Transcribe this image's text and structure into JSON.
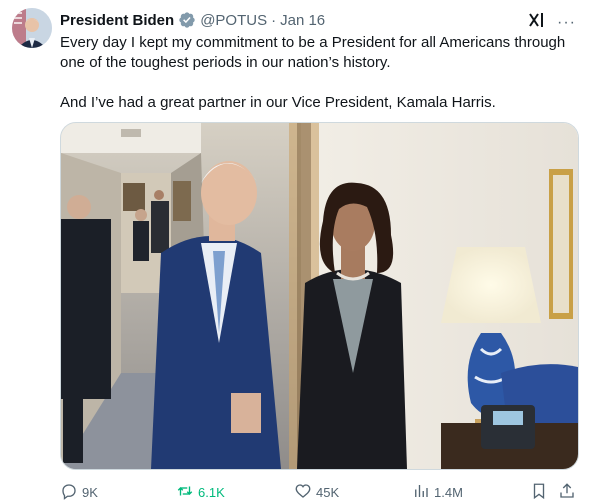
{
  "tweet": {
    "author_name": "President Biden",
    "handle": "@POTUS",
    "separator": "·",
    "date": "Jan 16",
    "more_label": "···",
    "paragraphs": [
      "Every day I kept my commitment to be a President for all Americans through one of the toughest periods in our nation’s history.",
      "And I’ve had a great partner in our Vice President, Kamala Harris."
    ]
  },
  "actions": {
    "replies": "9K",
    "reposts": "6.1K",
    "likes": "45K",
    "views": "1.4M"
  },
  "colors": {
    "verified_badge": "#829aab",
    "repost_active": "#00ba7c",
    "muted_text": "#536471"
  },
  "icons": [
    "verified-badge-icon",
    "grok-icon",
    "more-icon",
    "reply-icon",
    "repost-icon",
    "like-icon",
    "views-icon",
    "bookmark-icon",
    "share-icon"
  ]
}
